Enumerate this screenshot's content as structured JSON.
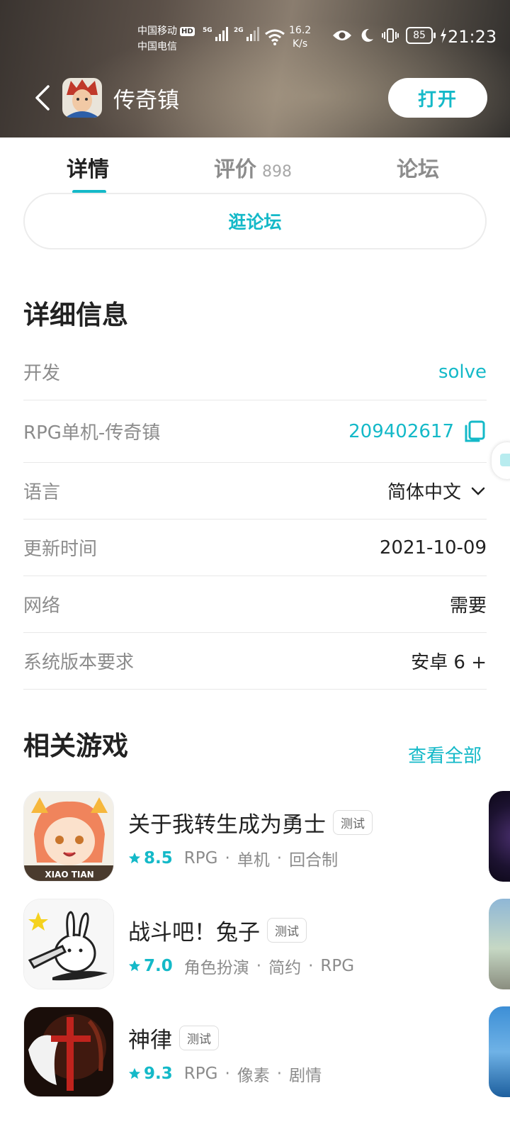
{
  "status_bar": {
    "carrier1": "中国移动",
    "hd": "HD",
    "carrier2": "中国电信",
    "sig1_label": "5G",
    "sig2_label": "2G",
    "speed_value": "16.2",
    "speed_unit": "K/s",
    "battery": "85",
    "time": "21:23"
  },
  "header": {
    "app_name": "传奇镇",
    "open_label": "打开"
  },
  "tabs": [
    {
      "label": "详情",
      "count": ""
    },
    {
      "label": "评价",
      "count": "898"
    },
    {
      "label": "论坛",
      "count": ""
    }
  ],
  "forum_button": "逛论坛",
  "details": {
    "title": "详细信息",
    "rows": [
      {
        "key": "开发",
        "value": "solve"
      },
      {
        "key": "RPG单机-传奇镇",
        "value": "209402617"
      },
      {
        "key": "语言",
        "value": "简体中文"
      },
      {
        "key": "更新时间",
        "value": "2021-10-09"
      },
      {
        "key": "网络",
        "value": "需要"
      },
      {
        "key": "系统版本要求",
        "value": "安卓 6 +"
      }
    ]
  },
  "related": {
    "title": "相关游戏",
    "see_all": "查看全部",
    "games": [
      {
        "name": "关于我转生成为勇士",
        "badge": "测试",
        "score": "8.5",
        "tags": [
          "RPG",
          "单机",
          "回合制"
        ],
        "icon_text": "XIAO TIAN"
      },
      {
        "name": "战斗吧！兔子",
        "badge": "测试",
        "score": "7.0",
        "tags": [
          "角色扮演",
          "简约",
          "RPG"
        ]
      },
      {
        "name": "神律",
        "badge": "测试",
        "score": "9.3",
        "tags": [
          "RPG",
          "像素",
          "剧情"
        ]
      }
    ]
  },
  "colors": {
    "accent": "#14b9c8",
    "muted": "#8c8c8c",
    "text": "#222222"
  }
}
